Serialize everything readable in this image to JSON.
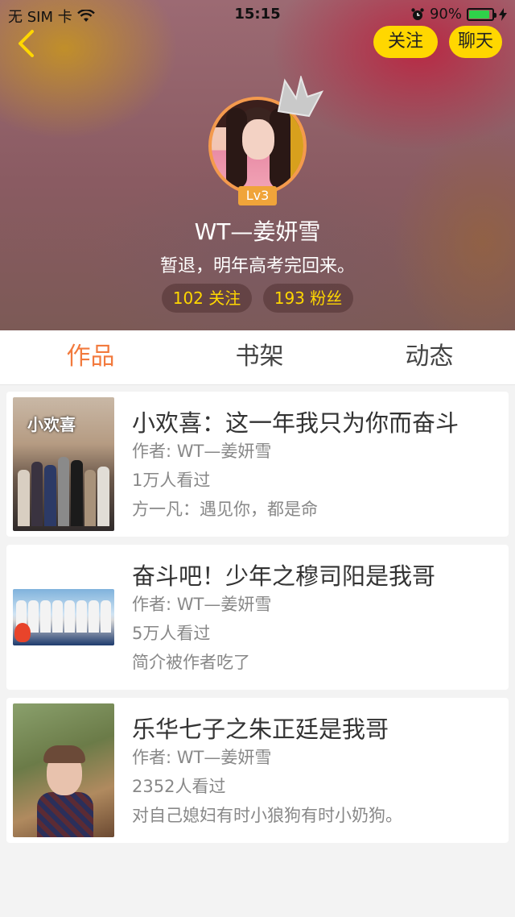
{
  "status_bar": {
    "carrier": "无 SIM 卡",
    "time": "15:15",
    "battery_percent": "90%",
    "battery_level": 0.9,
    "wifi_icon": "wifi-icon",
    "alarm_icon": "alarm-icon",
    "charging_icon": "charging-bolt-icon"
  },
  "header": {
    "back_icon": "chevron-left-icon",
    "follow_label": "关注",
    "chat_label": "聊天",
    "level": "Lv3",
    "username": "WT—姜妍雪",
    "bio": "暂退，明年高考完回来。",
    "following": "102 关注",
    "fans": "193 粉丝",
    "accent_color": "#ffd700"
  },
  "tabs": [
    {
      "label": "作品",
      "active": true
    },
    {
      "label": "书架",
      "active": false
    },
    {
      "label": "动态",
      "active": false
    }
  ],
  "works": [
    {
      "title": "小欢喜：这一年我只为你而奋斗",
      "author": "作者: WT—姜妍雪",
      "views": "1万人看过",
      "desc": "方一凡：遇见你，都是命",
      "cover_text": "小欢喜"
    },
    {
      "title": "奋斗吧！少年之穆司阳是我哥",
      "author": "作者: WT—姜妍雪",
      "views": "5万人看过",
      "desc": "简介被作者吃了"
    },
    {
      "title": "乐华七子之朱正廷是我哥",
      "author": "作者: WT—姜妍雪",
      "views": "2352人看过",
      "desc": "对自己媳妇有时小狼狗有时小奶狗。"
    }
  ],
  "colors": {
    "active_tab": "#f27a3d",
    "badge": "#f0a43a",
    "avatar_border": "#f49a4d"
  }
}
